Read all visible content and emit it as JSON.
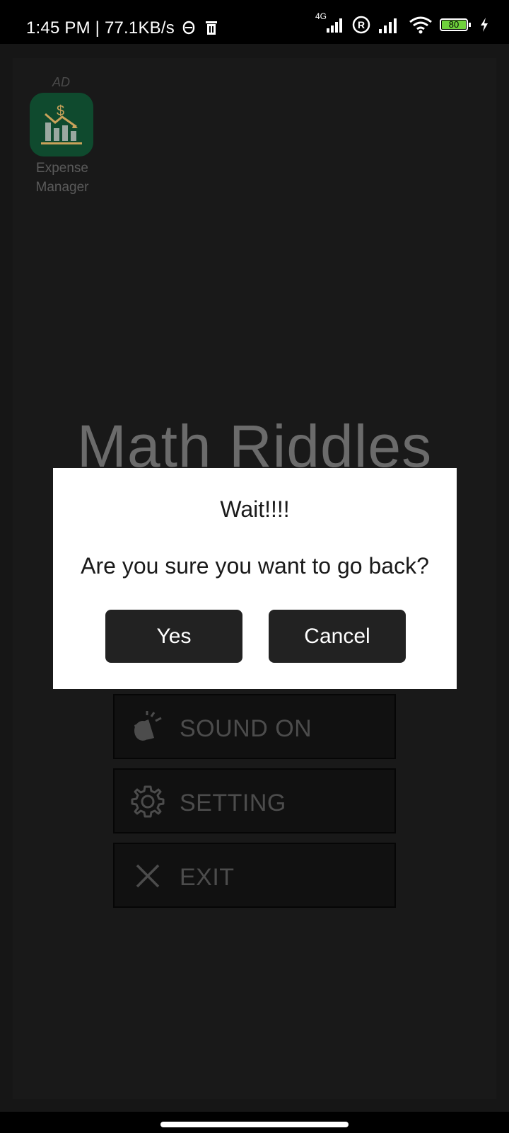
{
  "status_bar": {
    "time_speed": "1:45 PM | 77.1KB/s",
    "network_label": "4G",
    "battery": "80"
  },
  "ad": {
    "label": "AD",
    "app_name_line1": "Expense",
    "app_name_line2": "Manager",
    "icon": "expense-chart-icon"
  },
  "app": {
    "title": "Math Riddles",
    "menu": [
      {
        "label": "SOUND ON",
        "icon": "speaker-icon"
      },
      {
        "label": "SETTING",
        "icon": "gear-icon"
      },
      {
        "label": "EXIT",
        "icon": "close-icon"
      }
    ]
  },
  "dialog": {
    "title": "Wait!!!!",
    "message": "Are you sure you want to go back?",
    "yes_label": "Yes",
    "cancel_label": "Cancel"
  },
  "colors": {
    "overlay": "#000000",
    "screen_bg": "#191919",
    "dialog_bg": "#ffffff",
    "button_bg": "#222222",
    "battery_fill": "#6fd13c"
  }
}
